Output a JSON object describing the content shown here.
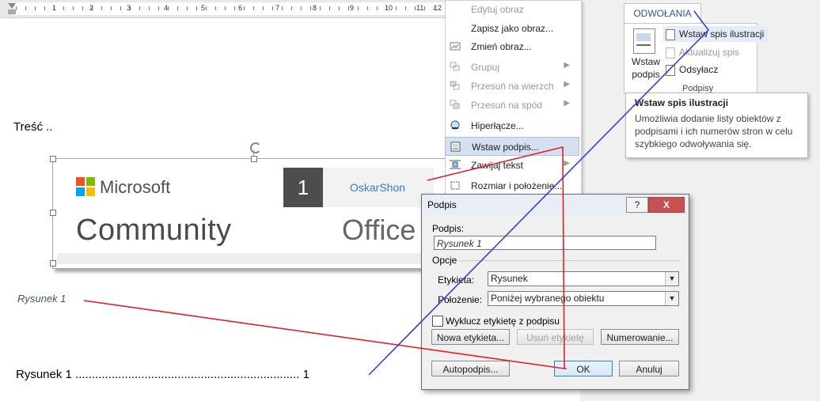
{
  "ruler": {
    "numbers": [
      "1",
      "2",
      "3",
      "4",
      "5",
      "6",
      "7",
      "8",
      "9",
      "10",
      "11",
      "12"
    ]
  },
  "document": {
    "body_text": "Treść ..",
    "caption_text": "Rysunek 1",
    "toc_entry": "Rysunek 1 .................................................................... 1"
  },
  "image": {
    "microsoft_text": "Microsoft",
    "community_text": "Community",
    "badge_number": "1",
    "username": "OskarShon",
    "office_text": "Office"
  },
  "context_menu": {
    "items": [
      {
        "label": "Edytuj obraz",
        "icon": "edit-picture-icon",
        "disabled": true,
        "submenu": false
      },
      {
        "label": "Zapisz jako obraz...",
        "icon": "",
        "disabled": false,
        "submenu": false
      },
      {
        "label": "Zmień obraz...",
        "icon": "",
        "disabled": false,
        "submenu": false
      },
      {
        "label": "Grupuj",
        "icon": "group-icon",
        "disabled": true,
        "submenu": true
      },
      {
        "label": "Przesuń na wierzch",
        "icon": "bring-forward-icon",
        "disabled": true,
        "submenu": true
      },
      {
        "label": "Przesuń na spód",
        "icon": "send-backward-icon",
        "disabled": true,
        "submenu": true
      },
      {
        "label": "Hiperłącze...",
        "icon": "hyperlink-icon",
        "disabled": false,
        "submenu": false
      },
      {
        "label": "Wstaw podpis...",
        "icon": "insert-caption-icon",
        "disabled": false,
        "submenu": false,
        "highlighted": true
      },
      {
        "label": "Zawijaj tekst",
        "icon": "wrap-text-icon",
        "disabled": false,
        "submenu": true
      },
      {
        "label": "Rozmiar i położenie...",
        "icon": "size-position-icon",
        "disabled": false,
        "submenu": false
      }
    ]
  },
  "ribbon": {
    "tab_label": "ODWOŁANIA",
    "insert_caption_label": "Wstaw\npodpis",
    "items": [
      {
        "label": "Wstaw spis ilustracji",
        "disabled": false,
        "highlighted": true
      },
      {
        "label": "Aktualizuj spis",
        "disabled": true,
        "highlighted": false
      },
      {
        "label": "Odsyłacz",
        "disabled": false,
        "highlighted": false
      }
    ],
    "group_label": "Podpisy"
  },
  "tooltip": {
    "title": "Wstaw spis ilustracji",
    "body": "Umożliwia dodanie listy obiektów z podpisami i ich numerów stron w celu szybkiego odwoływania się."
  },
  "dialog": {
    "title": "Podpis",
    "help_label": "?",
    "close_label": "X",
    "caption_label": "Podpis:",
    "caption_value": "Rysunek 1",
    "options_label": "Opcje",
    "label_label": "Etykieta:",
    "label_value": "Rysunek",
    "position_label": "Położenie:",
    "position_value": "Poniżej wybranego obiektu",
    "exclude_label": "Wyklucz etykietę z podpisu",
    "exclude_checked": false,
    "new_label_button": "Nowa etykieta...",
    "delete_label_button": "Usuń etykietę",
    "numbering_button": "Numerowanie...",
    "autocaption_button": "Autopodpis...",
    "ok_button": "OK",
    "cancel_button": "Anuluj"
  },
  "colors": {
    "red_annotation": "#e0202a",
    "blue_annotation": "#3a3fc8",
    "ribbon_accent": "#2b579a"
  }
}
